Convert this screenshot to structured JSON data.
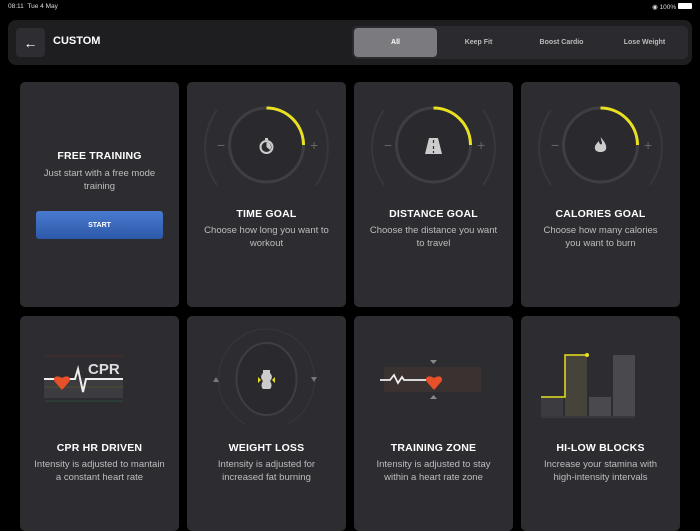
{
  "status": {
    "time": "08:11",
    "date": "Tue 4 May",
    "battery": "100%"
  },
  "header": {
    "title": "CUSTOM",
    "back_icon": "arrow-left-icon"
  },
  "tabs": [
    {
      "label": "All",
      "active": true
    },
    {
      "label": "Keep Fit"
    },
    {
      "label": "Boost Cardio"
    },
    {
      "label": "Lose Weight"
    }
  ],
  "accent": "#e8e020",
  "cards": [
    {
      "title": "FREE TRAINING",
      "desc": "Just start with a free mode training",
      "button": "START"
    },
    {
      "title": "TIME GOAL",
      "desc": "Choose how long you want to workout",
      "icon": "stopwatch-icon"
    },
    {
      "title": "DISTANCE GOAL",
      "desc": "Choose the distance you want to travel",
      "icon": "road-icon"
    },
    {
      "title": "CALORIES GOAL",
      "desc": "Choose how many calories you want to burn",
      "icon": "flame-icon"
    },
    {
      "title": "CPR HR DRIVEN",
      "desc": "Intensity is adjusted to mantain a constant heart rate",
      "label": "CPR"
    },
    {
      "title": "WEIGHT LOSS",
      "desc": "Intensity is adjusted for increased fat burning",
      "icon": "body-icon"
    },
    {
      "title": "TRAINING ZONE",
      "desc": "Intensity is adjusted to stay within a heart rate zone",
      "icon": "heart-icon"
    },
    {
      "title": "HI-LOW BLOCKS",
      "desc": "Increase your stamina with high-intensity intervals",
      "icon": "bars-icon"
    }
  ]
}
